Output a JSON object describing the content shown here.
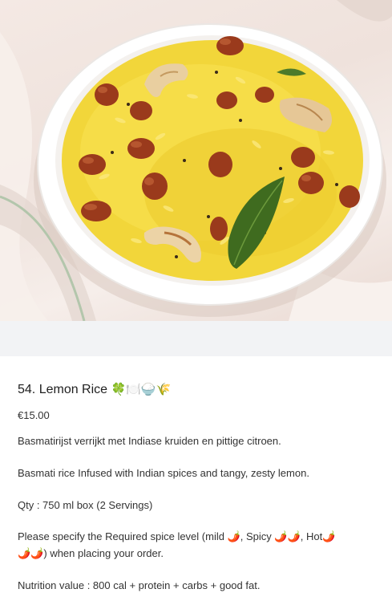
{
  "item": {
    "title": "54. Lemon Rice",
    "title_emojis": "🍀🍽️🍚🌾",
    "price": "€15.00",
    "image_alt": "Lemon rice with peanuts and cashews in a white bowl"
  },
  "description": {
    "dutch": "Basmatirijst verrijkt met Indiase kruiden en pittige citroen.",
    "english": "Basmati rice Infused with Indian spices and tangy, zesty lemon.",
    "qty": "Qty : 750 ml box (2 Servings)",
    "spice_line_1_part1": "Please specify the Required spice level (mild ",
    "chili_single": "🌶️",
    "spice_line_1_part2": ", Spicy ",
    "chili_double": "🌶️🌶️",
    "spice_line_1_part3": ", Hot",
    "chili_triple_first": "🌶️",
    "chili_triple_rest": "🌶️🌶️",
    "spice_line_2_end": ") when placing your order.",
    "nutrition": "Nutrition value : 800 cal + protein + carbs + good fat."
  },
  "colors": {
    "rice": "#f2d63a",
    "bowl": "#ffffff",
    "cloth": "#f1e4de",
    "gap": "#f2f3f5"
  }
}
